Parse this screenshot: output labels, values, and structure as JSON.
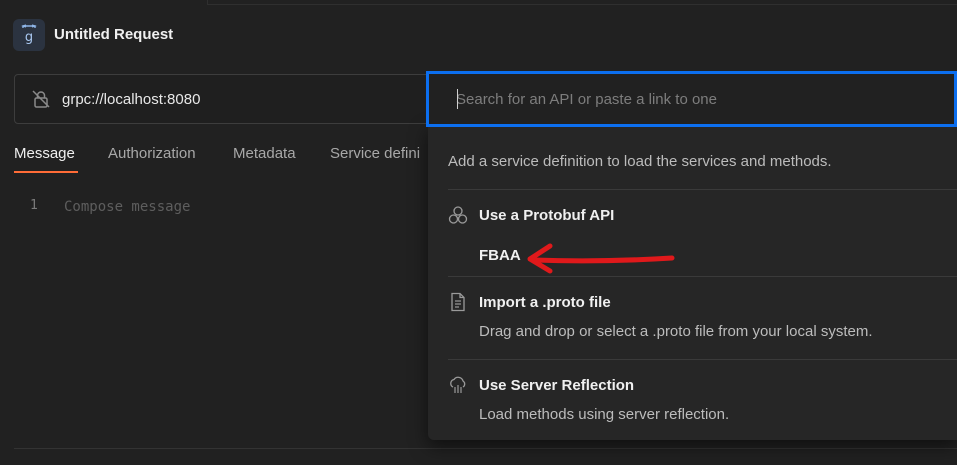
{
  "header": {
    "title": "Untitled Request",
    "icon": "grpc-icon"
  },
  "url_bar": {
    "value": "grpc://localhost:8080",
    "icon": "lock-off-icon"
  },
  "tabs": [
    {
      "label": "Message",
      "active": true
    },
    {
      "label": "Authorization",
      "active": false
    },
    {
      "label": "Metadata",
      "active": false
    },
    {
      "label": "Service defini",
      "active": false
    }
  ],
  "editor": {
    "line_number": "1",
    "placeholder": "Compose message"
  },
  "search": {
    "placeholder": "Search for an API or paste a link to one",
    "value": ""
  },
  "panel": {
    "hint": "Add a service definition to load the services and methods.",
    "options": [
      {
        "icon": "protobuf-api-icon",
        "title": "Use a Protobuf API",
        "items": [
          "FBAA"
        ]
      },
      {
        "icon": "proto-file-icon",
        "title": "Import a .proto file",
        "desc": "Drag and drop or select a .proto file from your local system."
      },
      {
        "icon": "server-reflection-icon",
        "title": "Use Server Reflection",
        "desc": "Load methods using server reflection."
      }
    ]
  },
  "colors": {
    "accent_tab": "#ff6c37",
    "focus_border": "#0c6ff0",
    "annotation_arrow": "#e0191b"
  }
}
